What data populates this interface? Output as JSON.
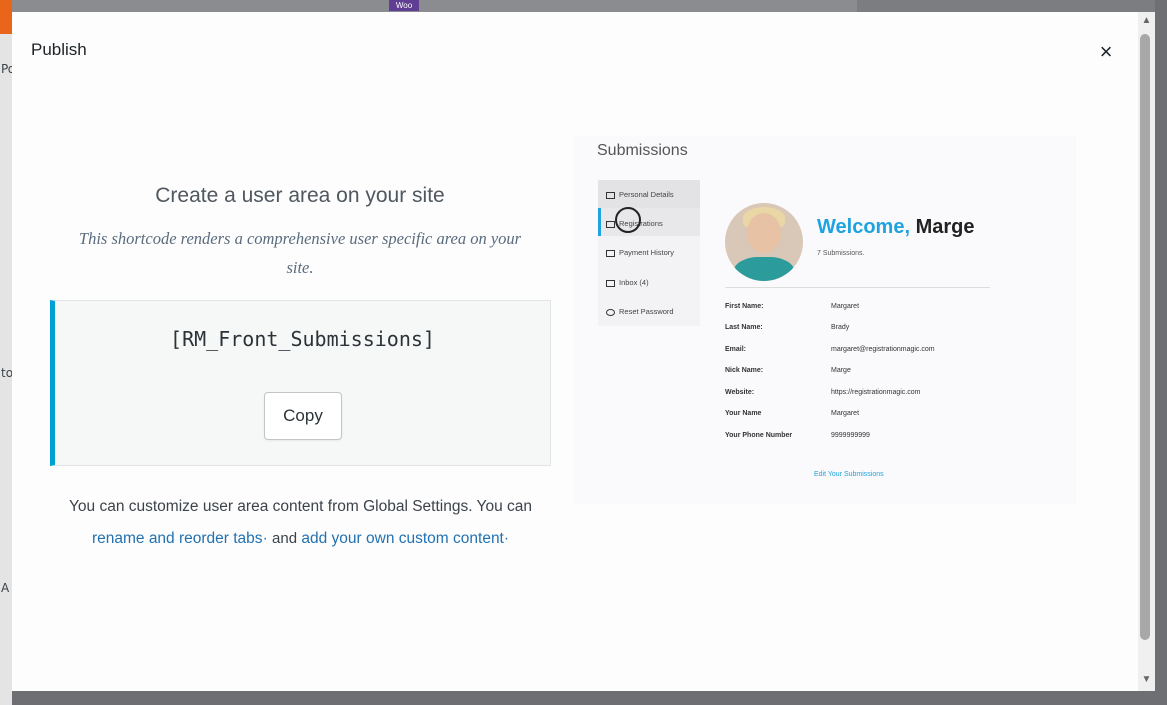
{
  "background": {
    "left_texts": [
      "Po",
      "to",
      "A"
    ],
    "woo_badge": "Woo"
  },
  "modal": {
    "title": "Publish",
    "close_symbol": "×"
  },
  "content": {
    "heading": "Create a user area on your site",
    "description": "This shortcode renders a comprehensive user specific area on your site.",
    "shortcode": "[RM_Front_Submissions]",
    "copy_label": "Copy",
    "note_prefix": "You can customize user area content from Global Settings. You can",
    "link_rename": "rename and reorder tabs",
    "note_and": "and",
    "link_custom": "add your own custom content"
  },
  "preview": {
    "title": "Submissions",
    "menu": [
      "Personal Details",
      "Registrations",
      "Payment History",
      "Inbox (4)",
      "Reset Password"
    ],
    "welcome": "Welcome,",
    "user_name": "Marge",
    "submissions_count": "7 Submissions.",
    "fields": [
      {
        "label": "First Name:",
        "value": "Margaret"
      },
      {
        "label": "Last Name:",
        "value": "Brady"
      },
      {
        "label": "Email:",
        "value": "margaret@registrationmagic.com"
      },
      {
        "label": "Nick Name:",
        "value": "Marge"
      },
      {
        "label": "Website:",
        "value": "https://registrationmagic.com"
      },
      {
        "label": "Your Name",
        "value": "Margaret"
      },
      {
        "label": "Your Phone Number",
        "value": "9999999999"
      }
    ],
    "edit_link": "Edit Your Submissions"
  },
  "colors": {
    "accent": "#00a0d2",
    "link": "#2271b1",
    "welcome_blue": "#1fa3e0"
  }
}
